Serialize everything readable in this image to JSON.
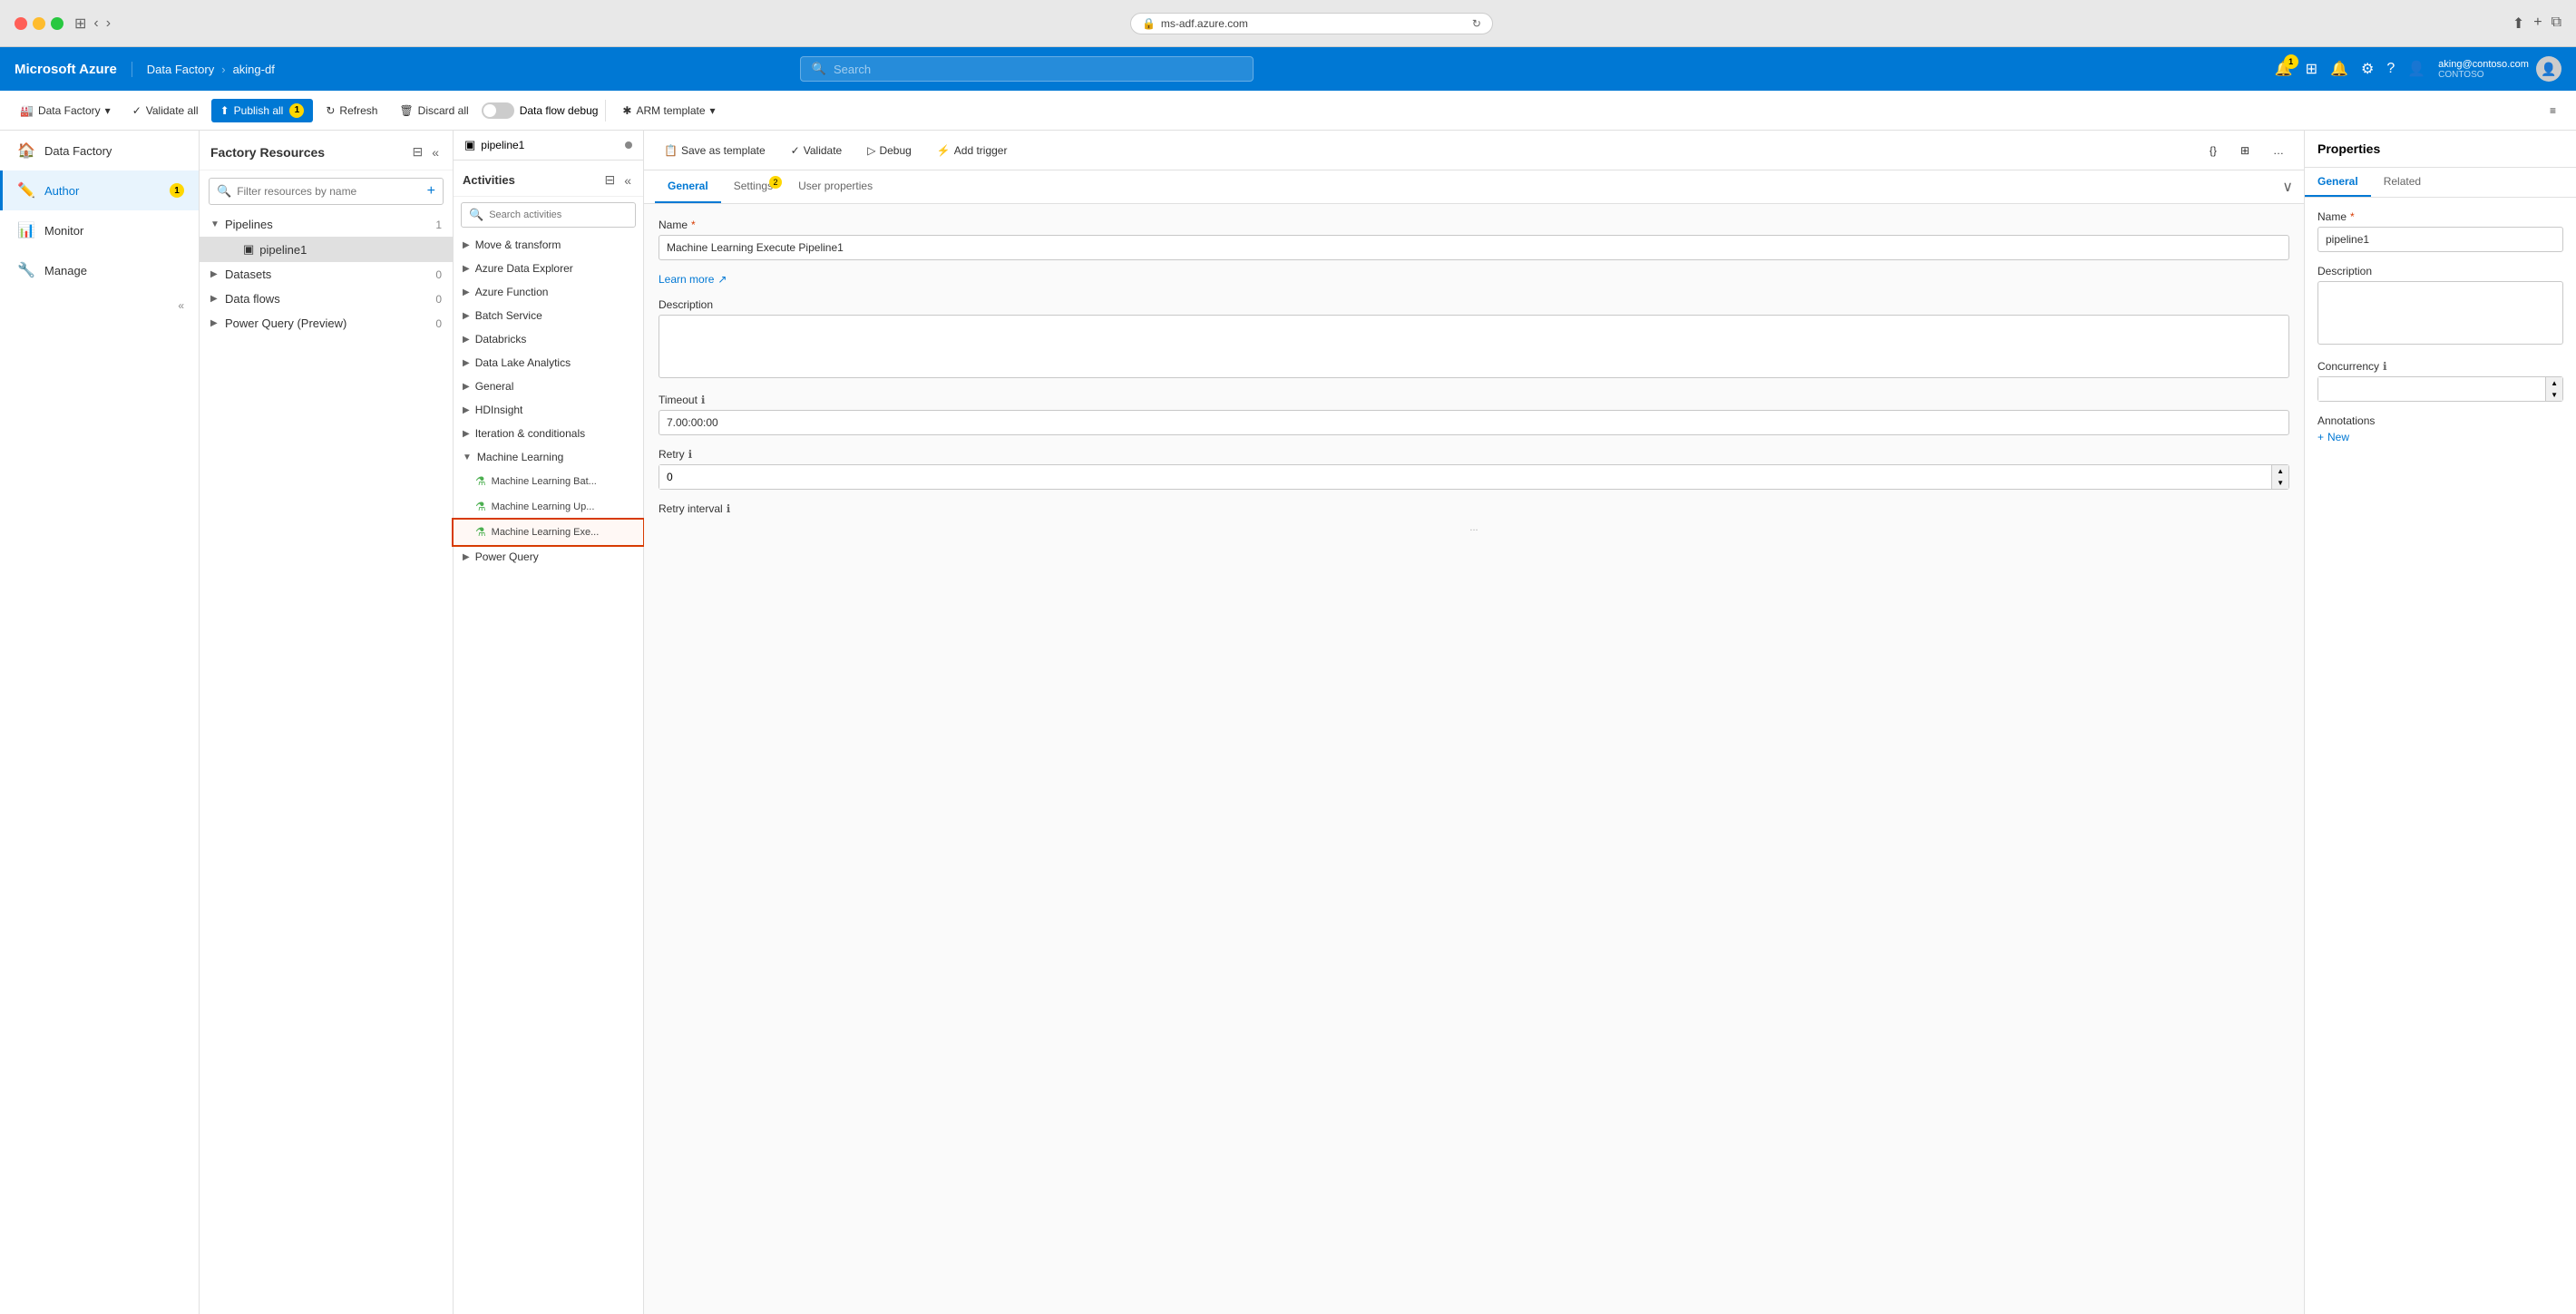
{
  "browser": {
    "url": "ms-adf.azure.com",
    "security_icon": "🔒"
  },
  "azure_nav": {
    "brand": "Microsoft Azure",
    "breadcrumb": [
      "Data Factory",
      "aking-df"
    ],
    "search_placeholder": "Search",
    "user_email": "aking@contoso.com",
    "user_org": "CONTOSO",
    "notifications_badge": "1"
  },
  "adf_toolbar": {
    "data_factory_label": "Data Factory",
    "validate_all_label": "Validate all",
    "publish_all_label": "Publish all",
    "publish_badge": "1",
    "refresh_label": "Refresh",
    "discard_all_label": "Discard all",
    "data_flow_debug_label": "Data flow debug",
    "arm_template_label": "ARM template"
  },
  "sidebar": {
    "items": [
      {
        "id": "data-factory",
        "label": "Data Factory",
        "icon": "🏠"
      },
      {
        "id": "author",
        "label": "Author",
        "icon": "✏️",
        "active": true,
        "badge": "1"
      },
      {
        "id": "monitor",
        "label": "Monitor",
        "icon": "📊"
      },
      {
        "id": "manage",
        "label": "Manage",
        "icon": "🔧"
      }
    ]
  },
  "factory_resources": {
    "title": "Factory Resources",
    "search_placeholder": "Filter resources by name",
    "tree": [
      {
        "label": "Pipelines",
        "count": "1",
        "expanded": true,
        "children": [
          {
            "label": "pipeline1",
            "icon": "pipeline",
            "selected": true
          }
        ]
      },
      {
        "label": "Datasets",
        "count": "0",
        "expanded": false
      },
      {
        "label": "Data flows",
        "count": "0",
        "expanded": false
      },
      {
        "label": "Power Query (Preview)",
        "count": "0",
        "expanded": false
      }
    ]
  },
  "pipeline_tab": {
    "label": "pipeline1"
  },
  "activities": {
    "title": "Activities",
    "search_placeholder": "Search activities",
    "categories": [
      {
        "label": "Move & transform",
        "expanded": false
      },
      {
        "label": "Azure Data Explorer",
        "expanded": false
      },
      {
        "label": "Azure Function",
        "expanded": false
      },
      {
        "label": "Batch Service",
        "expanded": false
      },
      {
        "label": "Databricks",
        "expanded": false
      },
      {
        "label": "Data Lake Analytics",
        "expanded": false
      },
      {
        "label": "General",
        "expanded": false
      },
      {
        "label": "HDInsight",
        "expanded": false
      },
      {
        "label": "Iteration & conditionals",
        "expanded": false
      },
      {
        "label": "Machine Learning",
        "expanded": true,
        "children": [
          {
            "label": "Machine Learning Bat...",
            "icon": "🔬",
            "selected": false
          },
          {
            "label": "Machine Learning Up...",
            "icon": "🔬",
            "selected": false
          },
          {
            "label": "Machine Learning Exe...",
            "icon": "🔬",
            "selected": true
          }
        ]
      },
      {
        "label": "Power Query",
        "expanded": false
      }
    ]
  },
  "canvas_toolbar": {
    "save_template_label": "Save as template",
    "validate_label": "Validate",
    "debug_label": "Debug",
    "add_trigger_label": "Add trigger"
  },
  "props_tabs": {
    "tabs": [
      {
        "label": "General",
        "active": true
      },
      {
        "label": "Settings",
        "active": false,
        "badge": "2"
      },
      {
        "label": "User properties",
        "active": false
      }
    ]
  },
  "general_form": {
    "name_label": "Name",
    "name_required": true,
    "name_value": "Machine Learning Execute Pipeline1",
    "learn_more_label": "Learn more",
    "description_label": "Description",
    "description_value": "",
    "timeout_label": "Timeout",
    "timeout_value": "7.00:00:00",
    "retry_label": "Retry",
    "retry_value": "0",
    "retry_interval_label": "Retry interval"
  },
  "right_panel": {
    "title": "Properties",
    "tabs": [
      {
        "label": "General",
        "active": true
      },
      {
        "label": "Related",
        "active": false
      }
    ],
    "name_label": "Name",
    "name_required": true,
    "name_value": "pipeline1",
    "description_label": "Description",
    "description_value": "",
    "concurrency_label": "Concurrency",
    "annotations_label": "Annotations",
    "new_label": "New"
  }
}
